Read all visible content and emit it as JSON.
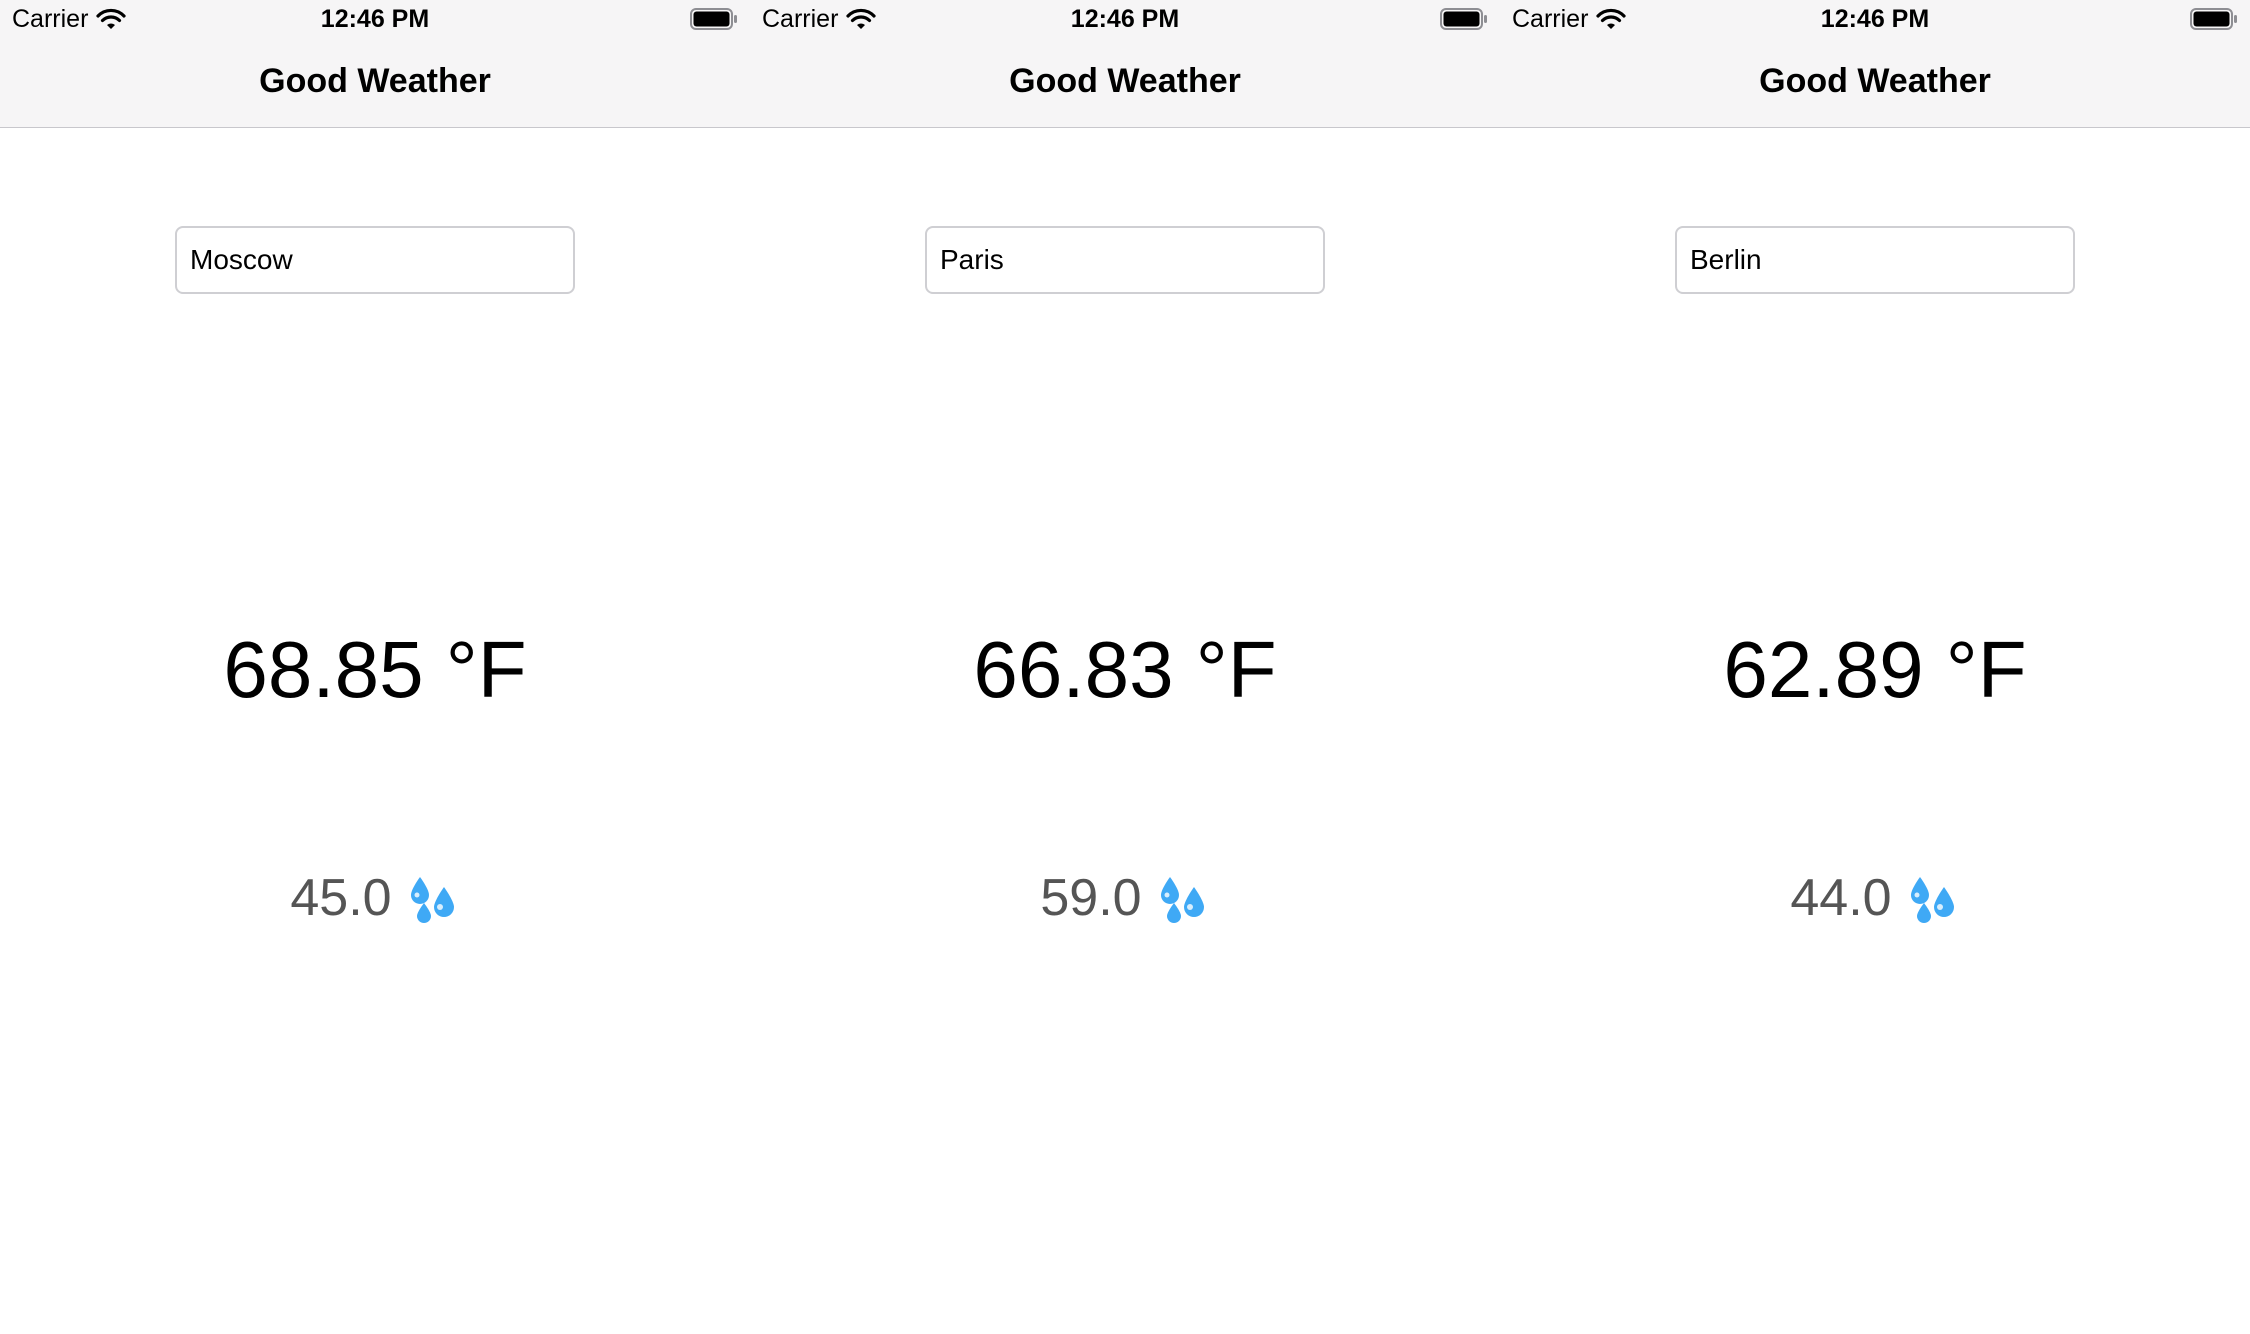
{
  "screens": [
    {
      "status": {
        "carrier": "Carrier",
        "time": "12:46 PM"
      },
      "nav": {
        "title": "Good Weather"
      },
      "city": {
        "value": "Moscow"
      },
      "weather": {
        "temperature": "68.85 °F",
        "humidity": "45.0"
      }
    },
    {
      "status": {
        "carrier": "Carrier",
        "time": "12:46 PM"
      },
      "nav": {
        "title": "Good Weather"
      },
      "city": {
        "value": "Paris"
      },
      "weather": {
        "temperature": "66.83 °F",
        "humidity": "59.0"
      }
    },
    {
      "status": {
        "carrier": "Carrier",
        "time": "12:46 PM"
      },
      "nav": {
        "title": "Good Weather"
      },
      "city": {
        "value": "Berlin"
      },
      "weather": {
        "temperature": "62.89 °F",
        "humidity": "44.0"
      }
    }
  ],
  "icons": {
    "wifi": "wifi-icon",
    "battery": "battery-icon",
    "humidity": "sweat-droplets-icon"
  },
  "colors": {
    "nav_background": "#f6f5f6",
    "humidity_text": "#555555",
    "droplet": "#3fa9f5"
  }
}
